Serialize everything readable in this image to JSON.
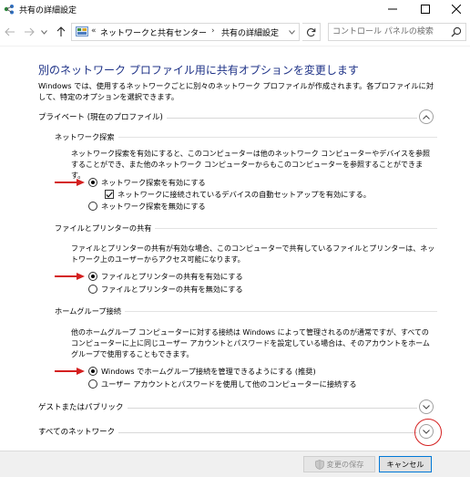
{
  "window": {
    "title": "共有の詳細設定",
    "icons": {
      "app": "network-share-icon",
      "minimize": "minimize-icon",
      "maximize": "maximize-icon",
      "close": "close-icon"
    }
  },
  "nav": {
    "breadcrumb_prefix": "«",
    "breadcrumbs": [
      "ネットワークと共有センター",
      "共有の詳細設定"
    ],
    "breadcrumb_separator": "›",
    "search_placeholder": "コントロール パネルの検索"
  },
  "content": {
    "heading": "別のネットワーク プロファイル用に共有オプションを変更します",
    "description": "Windows では、使用するネットワークごとに別々のネットワーク プロファイルが作成されます。各プロファイルに対して、特定のオプションを選択できます。",
    "private_profile": {
      "label": "プライベート (現在のプロファイル)",
      "expanded": true,
      "network_discovery": {
        "title": "ネットワーク探索",
        "description": "ネットワーク探索を有効にすると、このコンピューターは他のネットワーク コンピューターやデバイスを参照することができ、また他のネットワーク コンピューターからもこのコンピューターを参照することができます。",
        "on_label": "ネットワーク探索を有効にする",
        "auto_setup_label": "ネットワークに接続されているデバイスの自動セットアップを有効にする。",
        "off_label": "ネットワーク探索を無効にする",
        "selected": "on",
        "auto_setup_checked": true
      },
      "file_printer_sharing": {
        "title": "ファイルとプリンターの共有",
        "description": "ファイルとプリンターの共有が有効な場合、このコンピューターで共有しているファイルとプリンターは、ネットワーク上のユーザーからアクセス可能になります。",
        "on_label": "ファイルとプリンターの共有を有効にする",
        "off_label": "ファイルとプリンターの共有を無効にする",
        "selected": "on"
      },
      "homegroup": {
        "title": "ホームグループ接続",
        "description": "他のホームグループ コンピューターに対する接続は Windows によって管理されるのが通常ですが、すべてのコンピューターに上に同じユーザー アカウントとパスワードを設定している場合は、そのアカウントをホームグループで使用することもできます。",
        "windows_label": "Windows でホームグループ接続を管理できるようにする (推奨)",
        "account_label": "ユーザー アカウントとパスワードを使用して他のコンピューターに接続する",
        "selected": "windows"
      }
    },
    "guest_profile": {
      "label": "ゲストまたはパブリック",
      "expanded": false
    },
    "all_networks": {
      "label": "すべてのネットワーク",
      "expanded": false
    }
  },
  "footer": {
    "save_label": "変更の保存",
    "cancel_label": "キャンセル"
  },
  "colors": {
    "heading": "#1e3287",
    "annotation": "#d42020",
    "focus_border": "#0078d7"
  }
}
